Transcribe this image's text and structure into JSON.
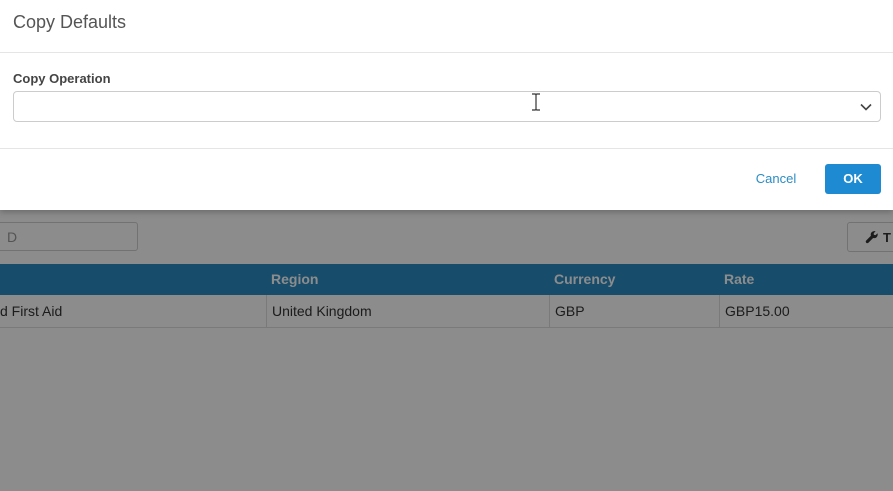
{
  "dialog": {
    "title": "Copy Defaults",
    "field_label": "Copy Operation",
    "select_value": "",
    "cancel_label": "Cancel",
    "ok_label": "OK"
  },
  "background": {
    "search_text": "D",
    "tool_button_label": "T",
    "table": {
      "columns": [
        "",
        "Region",
        "Currency",
        "Rate"
      ],
      "rows": [
        [
          "d First Aid",
          "United Kingdom",
          "GBP",
          "GBP15.00"
        ]
      ]
    }
  },
  "colors": {
    "accent": "#2b8cc4",
    "ok_button": "#1e8ad2"
  },
  "icons": {
    "select_chevron": "chevron-down-icon",
    "tool_button": "wrench-icon",
    "cursor": "text-cursor-icon"
  }
}
